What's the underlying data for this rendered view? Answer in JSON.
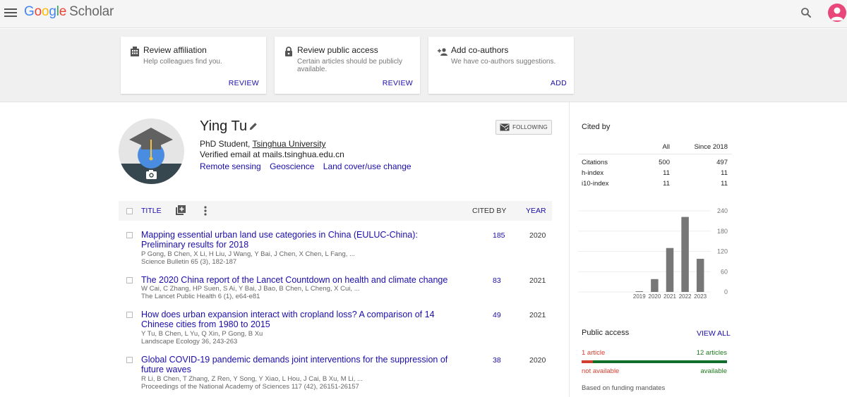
{
  "header": {
    "logo": {
      "g1": "G",
      "g2": "o",
      "g3": "o",
      "g4": "g",
      "g5": "l",
      "g6": "e",
      "product": "Scholar"
    }
  },
  "banner": {
    "cards": [
      {
        "title": "Review affiliation",
        "desc": "Help colleagues find you.",
        "action": "REVIEW",
        "icon": "building-icon"
      },
      {
        "title": "Review public access",
        "desc": "Certain articles should be publicly available.",
        "action": "REVIEW",
        "icon": "lock-icon"
      },
      {
        "title": "Add co-authors",
        "desc": "We have co-authors suggestions.",
        "action": "ADD",
        "icon": "add-person-icon"
      }
    ]
  },
  "profile": {
    "name": "Ying Tu",
    "position": "PhD Student, ",
    "affiliation": "Tsinghua University",
    "email": "Verified email at mails.tsinghua.edu.cn",
    "interests": [
      "Remote sensing",
      "Geoscience",
      "Land cover/use change"
    ],
    "follow_label": "FOLLOWING"
  },
  "table": {
    "col_title": "TITLE",
    "col_cited": "CITED BY",
    "col_year": "YEAR",
    "rows": [
      {
        "title": "Mapping essential urban land use categories in China (EULUC-China): Preliminary results for 2018",
        "authors": "P Gong, B Chen, X Li, H Liu, J Wang, Y Bai, J Chen, X Chen, L Fang, ...",
        "venue": "Science Bulletin 65 (3), 182-187",
        "cited": "185",
        "year": "2020"
      },
      {
        "title": "The 2020 China report of the Lancet Countdown on health and climate change",
        "authors": "W Cai, C Zhang, HP Suen, S Ai, Y Bai, J Bao, B Chen, L Cheng, X Cui, ...",
        "venue": "The Lancet Public Health 6 (1), e64-e81",
        "cited": "83",
        "year": "2021"
      },
      {
        "title": "How does urban expansion interact with cropland loss? A comparison of 14 Chinese cities from 1980 to 2015",
        "authors": "Y Tu, B Chen, L Yu, Q Xin, P Gong, B Xu",
        "venue": "Landscape Ecology 36, 243-263",
        "cited": "49",
        "year": "2021"
      },
      {
        "title": "Global COVID-19 pandemic demands joint interventions for the suppression of future waves",
        "authors": "R Li, B Chen, T Zhang, Z Ren, Y Song, Y Xiao, L Hou, J Cai, B Xu, M Li, ...",
        "venue": "Proceedings of the National Academy of Sciences 117 (42), 26151-26157",
        "cited": "38",
        "year": "2020"
      }
    ]
  },
  "sidebar": {
    "cited_by": "Cited by",
    "col_all": "All",
    "col_since": "Since 2018",
    "metrics": [
      {
        "label": "Citations",
        "all": "500",
        "since": "497"
      },
      {
        "label": "h-index",
        "all": "11",
        "since": "11"
      },
      {
        "label": "i10-index",
        "all": "11",
        "since": "11"
      }
    ],
    "public_access": {
      "title": "Public access",
      "view_all": "VIEW ALL",
      "not_available_count": "1 article",
      "available_count": "12 articles",
      "not_available": "not available",
      "available": "available",
      "note": "Based on funding mandates",
      "available_fraction": 0.923
    }
  },
  "chart_data": {
    "type": "bar",
    "categories": [
      "2019",
      "2020",
      "2021",
      "2022",
      "2023"
    ],
    "values": [
      2,
      38,
      130,
      222,
      98
    ],
    "yticks": [
      0,
      60,
      120,
      180,
      240
    ],
    "ylim": [
      0,
      240
    ],
    "bar_color": "#777777"
  }
}
